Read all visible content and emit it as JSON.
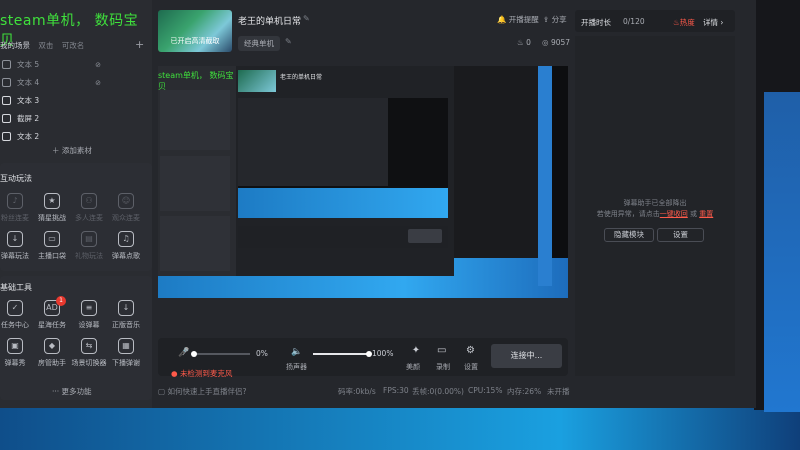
{
  "overlay": {
    "text": "steam单机， 数码宝贝"
  },
  "stream": {
    "title": "老王的单机日常",
    "thumb_text": "已开启高清截取",
    "category": "经典单机",
    "reminder_label": "开播提醒",
    "share_label": "分享",
    "likes": "0",
    "views": "9057"
  },
  "stats": {
    "duration_label": "开播时长",
    "count": "0/120",
    "hot_label": "热度",
    "detail_label": "详情"
  },
  "scenes": {
    "header_label": "我的场景",
    "tab_double": "双击",
    "tab_rename": "可改名",
    "items": [
      {
        "label": "文本 5",
        "active": false
      },
      {
        "label": "文本 4",
        "active": false
      },
      {
        "label": "文本 3",
        "active": true
      },
      {
        "label": "截屏 2",
        "active": true
      },
      {
        "label": "文本 2",
        "active": true
      }
    ],
    "add_label": "添加素材"
  },
  "interactive": {
    "title": "互动玩法",
    "tools": [
      {
        "label": "粉丝连麦",
        "icon": "mic-icon",
        "dim": true
      },
      {
        "label": "猜星挑战",
        "icon": "star-icon",
        "dim": false
      },
      {
        "label": "多人连麦",
        "icon": "group-icon",
        "dim": true
      },
      {
        "label": "观众连麦",
        "icon": "user-icon",
        "dim": true
      },
      {
        "label": "弹幕玩法",
        "icon": "download-icon",
        "dim": false
      },
      {
        "label": "主播口袋",
        "icon": "pocket-icon",
        "dim": false
      },
      {
        "label": "礼物玩法",
        "icon": "gift-icon",
        "dim": true
      },
      {
        "label": "弹幕点歌",
        "icon": "music-icon",
        "dim": false
      }
    ]
  },
  "basic": {
    "title": "基础工具",
    "tools": [
      {
        "label": "任务中心",
        "icon": "task-icon"
      },
      {
        "label": "星海任务",
        "icon": "ad-icon",
        "badge": "1"
      },
      {
        "label": "设弹幕",
        "icon": "danmaku-icon"
      },
      {
        "label": "正版音乐",
        "icon": "download-icon"
      },
      {
        "label": "弹幕秀",
        "icon": "tv-icon"
      },
      {
        "label": "房管助手",
        "icon": "shield-icon"
      },
      {
        "label": "场景切换器",
        "icon": "switch-icon"
      },
      {
        "label": "下播弹谢",
        "icon": "calendar-icon"
      }
    ],
    "more_label": "更多功能"
  },
  "danmaku": {
    "line1": "弹幕助手已全部降出",
    "line2_prefix": "若使用异常，请点击",
    "line2_link1": "一键收回",
    "line2_mid": "或",
    "line2_link2": "重置",
    "hide_label": "隐藏模块",
    "settings_label": "设置"
  },
  "controls": {
    "mic_volume": "0%",
    "speaker_volume": "100%",
    "speaker_label": "扬声器",
    "beauty_label": "美颜",
    "record_label": "录制",
    "settings_label": "设置",
    "connect_label": "连接中...",
    "mic_fill": 0.0,
    "speaker_fill": 1.0
  },
  "warning": {
    "text": "未检测到麦克风"
  },
  "status": {
    "help": "如何快速上手直播伴侣?",
    "net": "码率:0kb/s",
    "fps": "FPS:30",
    "drop": "丢帧:0(0.00%)",
    "cpu": "CPU:15%",
    "mem": "内存:26%",
    "state": "未开播"
  }
}
